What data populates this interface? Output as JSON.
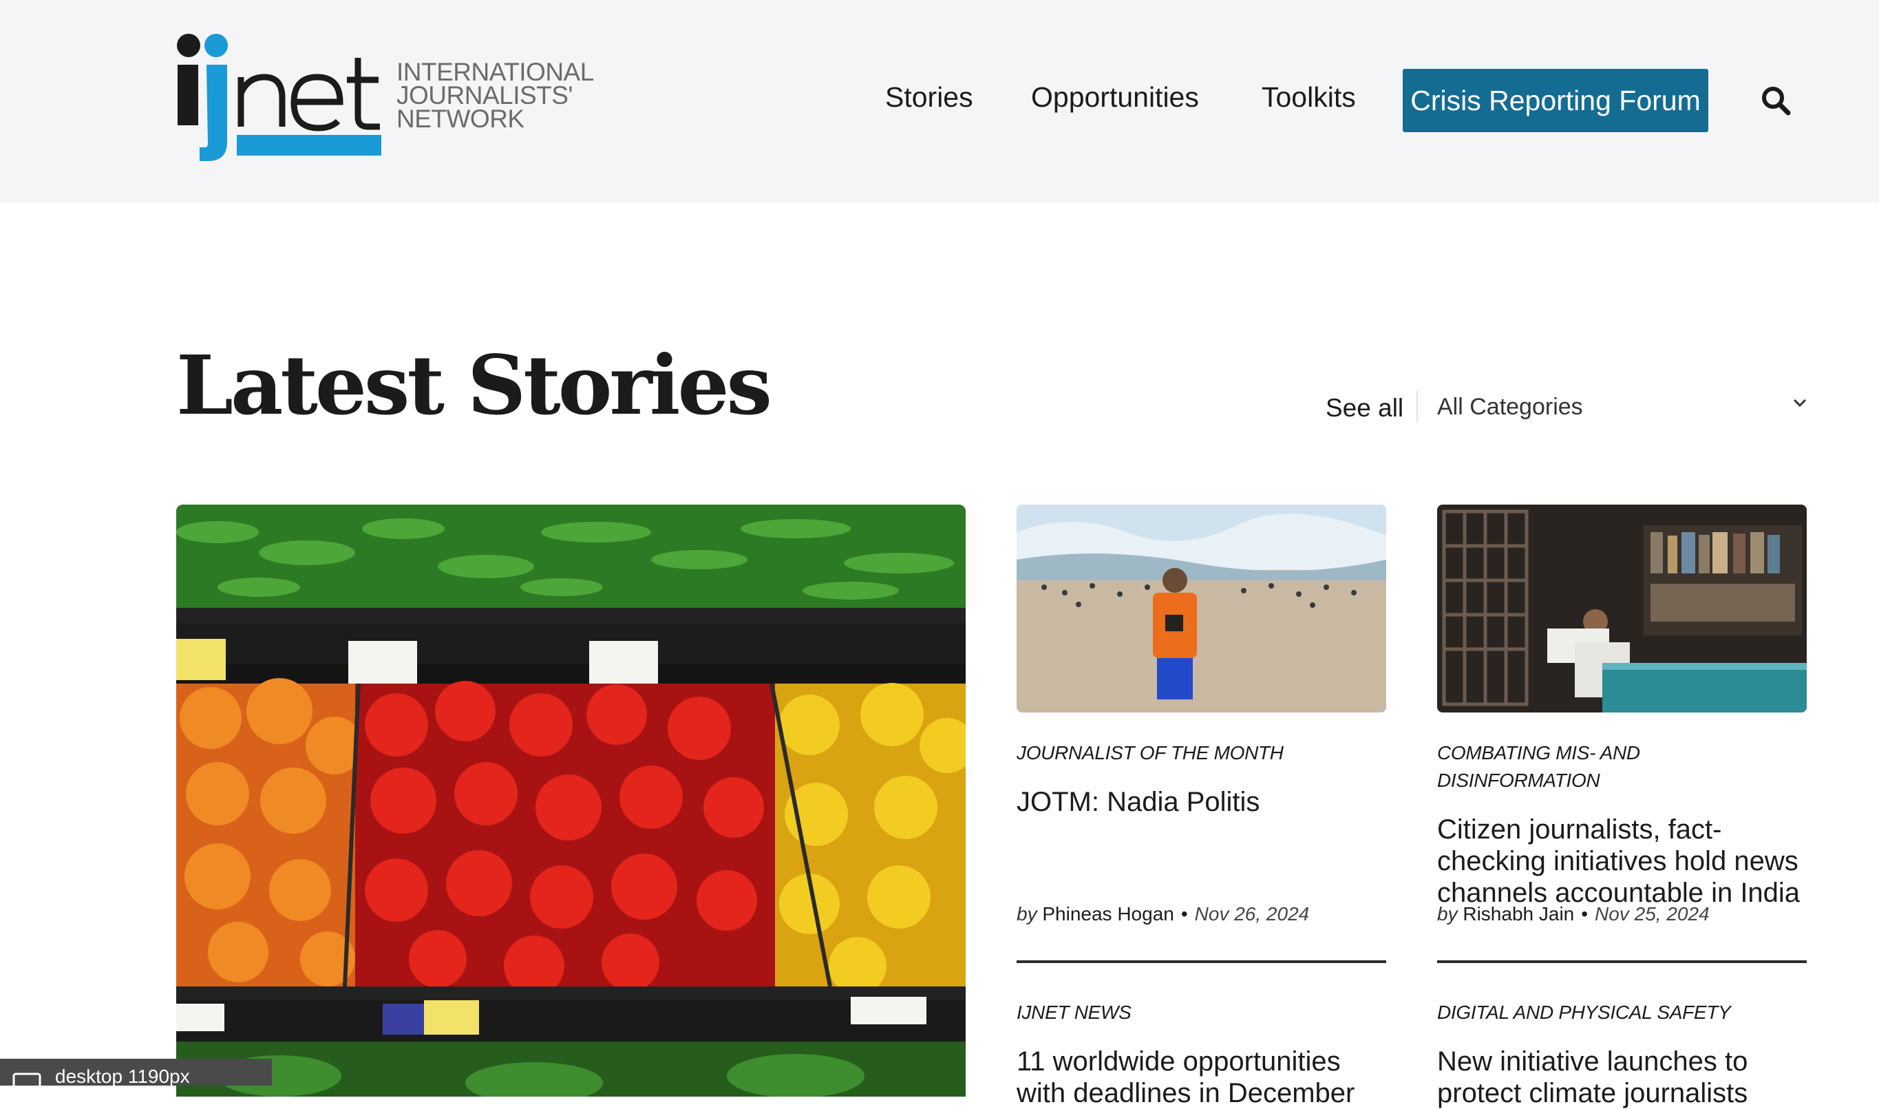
{
  "header": {
    "logo": {
      "wordmark": "ijnet",
      "subtitle_lines": [
        "INTERNATIONAL",
        "JOURNALISTS'",
        "NETWORK"
      ]
    },
    "nav": {
      "stories": "Stories",
      "opportunities": "Opportunities",
      "toolkits": "Toolkits",
      "cta": "Crisis Reporting Forum"
    },
    "search_icon": "search-icon"
  },
  "section": {
    "title": "Latest Stories",
    "see_all": "See all",
    "category_filter": "All Categories"
  },
  "cards": [
    {
      "category": "JOURNALIST OF THE MONTH",
      "title": "JOTM: Nadia Politis",
      "by": "by",
      "author": "Phineas Hogan",
      "date": "Nov 26, 2024"
    },
    {
      "category": "COMBATING MIS- AND DISINFORMATION",
      "title": "Citizen journalists, fact-checking initiatives hold news channels accountable in India",
      "by": "by",
      "author": "Rishabh Jain",
      "date": "Nov 25, 2024"
    },
    {
      "category": "IJNET NEWS",
      "title": "11 worldwide opportunities with deadlines in December"
    },
    {
      "category": "DIGITAL AND PHYSICAL SAFETY",
      "title": "New initiative launches to protect climate journalists"
    }
  ],
  "colors": {
    "accent": "#156c93",
    "logo_blue": "#1a9ad7",
    "header_bg": "#f5f5f7",
    "text": "#1b1b1b"
  },
  "dev_badge": "desktop 1190px"
}
